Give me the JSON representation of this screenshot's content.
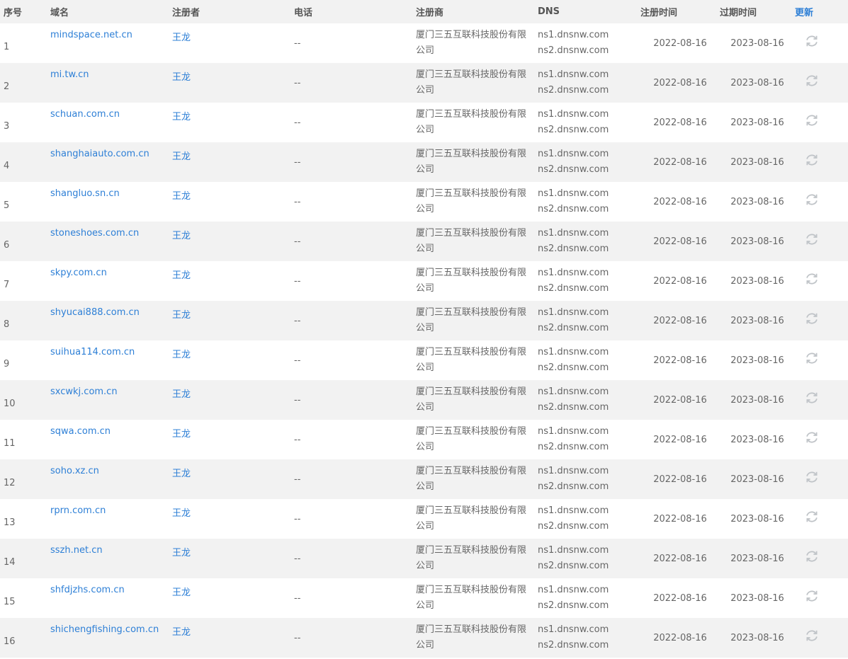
{
  "colors": {
    "link": "#2d7fd6",
    "row_alt": "#f2f2f2",
    "text": "#666666",
    "icon": "#c0c4c8"
  },
  "table": {
    "headers": {
      "index": "序号",
      "domain": "域名",
      "registrant": "注册者",
      "phone": "电话",
      "registrar": "注册商",
      "dns": "DNS",
      "reg_date": "注册时间",
      "exp_date": "过期时间",
      "update": "更新"
    },
    "rows": [
      {
        "index": "1",
        "domain": "mindspace.net.cn",
        "registrant": "王龙",
        "phone": "--",
        "registrar": "厦门三五互联科技股份有限公司",
        "dns1": "ns1.dnsnw.com",
        "dns2": "ns2.dnsnw.com",
        "reg_date": "2022-08-16",
        "exp_date": "2023-08-16",
        "update_icon": "refresh-icon"
      },
      {
        "index": "2",
        "domain": "mi.tw.cn",
        "registrant": "王龙",
        "phone": "--",
        "registrar": "厦门三五互联科技股份有限公司",
        "dns1": "ns1.dnsnw.com",
        "dns2": "ns2.dnsnw.com",
        "reg_date": "2022-08-16",
        "exp_date": "2023-08-16",
        "update_icon": "refresh-icon"
      },
      {
        "index": "3",
        "domain": "schuan.com.cn",
        "registrant": "王龙",
        "phone": "--",
        "registrar": "厦门三五互联科技股份有限公司",
        "dns1": "ns1.dnsnw.com",
        "dns2": "ns2.dnsnw.com",
        "reg_date": "2022-08-16",
        "exp_date": "2023-08-16",
        "update_icon": "refresh-icon"
      },
      {
        "index": "4",
        "domain": "shanghaiauto.com.cn",
        "registrant": "王龙",
        "phone": "--",
        "registrar": "厦门三五互联科技股份有限公司",
        "dns1": "ns1.dnsnw.com",
        "dns2": "ns2.dnsnw.com",
        "reg_date": "2022-08-16",
        "exp_date": "2023-08-16",
        "update_icon": "refresh-icon"
      },
      {
        "index": "5",
        "domain": "shangluo.sn.cn",
        "registrant": "王龙",
        "phone": "--",
        "registrar": "厦门三五互联科技股份有限公司",
        "dns1": "ns1.dnsnw.com",
        "dns2": "ns2.dnsnw.com",
        "reg_date": "2022-08-16",
        "exp_date": "2023-08-16",
        "update_icon": "refresh-icon"
      },
      {
        "index": "6",
        "domain": "stoneshoes.com.cn",
        "registrant": "王龙",
        "phone": "--",
        "registrar": "厦门三五互联科技股份有限公司",
        "dns1": "ns1.dnsnw.com",
        "dns2": "ns2.dnsnw.com",
        "reg_date": "2022-08-16",
        "exp_date": "2023-08-16",
        "update_icon": "refresh-icon"
      },
      {
        "index": "7",
        "domain": "skpy.com.cn",
        "registrant": "王龙",
        "phone": "--",
        "registrar": "厦门三五互联科技股份有限公司",
        "dns1": "ns1.dnsnw.com",
        "dns2": "ns2.dnsnw.com",
        "reg_date": "2022-08-16",
        "exp_date": "2023-08-16",
        "update_icon": "refresh-icon"
      },
      {
        "index": "8",
        "domain": "shyucai888.com.cn",
        "registrant": "王龙",
        "phone": "--",
        "registrar": "厦门三五互联科技股份有限公司",
        "dns1": "ns1.dnsnw.com",
        "dns2": "ns2.dnsnw.com",
        "reg_date": "2022-08-16",
        "exp_date": "2023-08-16",
        "update_icon": "refresh-icon"
      },
      {
        "index": "9",
        "domain": "suihua114.com.cn",
        "registrant": "王龙",
        "phone": "--",
        "registrar": "厦门三五互联科技股份有限公司",
        "dns1": "ns1.dnsnw.com",
        "dns2": "ns2.dnsnw.com",
        "reg_date": "2022-08-16",
        "exp_date": "2023-08-16",
        "update_icon": "refresh-icon"
      },
      {
        "index": "10",
        "domain": "sxcwkj.com.cn",
        "registrant": "王龙",
        "phone": "--",
        "registrar": "厦门三五互联科技股份有限公司",
        "dns1": "ns1.dnsnw.com",
        "dns2": "ns2.dnsnw.com",
        "reg_date": "2022-08-16",
        "exp_date": "2023-08-16",
        "update_icon": "refresh-icon"
      },
      {
        "index": "11",
        "domain": "sqwa.com.cn",
        "registrant": "王龙",
        "phone": "--",
        "registrar": "厦门三五互联科技股份有限公司",
        "dns1": "ns1.dnsnw.com",
        "dns2": "ns2.dnsnw.com",
        "reg_date": "2022-08-16",
        "exp_date": "2023-08-16",
        "update_icon": "refresh-icon"
      },
      {
        "index": "12",
        "domain": "soho.xz.cn",
        "registrant": "王龙",
        "phone": "--",
        "registrar": "厦门三五互联科技股份有限公司",
        "dns1": "ns1.dnsnw.com",
        "dns2": "ns2.dnsnw.com",
        "reg_date": "2022-08-16",
        "exp_date": "2023-08-16",
        "update_icon": "refresh-icon"
      },
      {
        "index": "13",
        "domain": "rprn.com.cn",
        "registrant": "王龙",
        "phone": "--",
        "registrar": "厦门三五互联科技股份有限公司",
        "dns1": "ns1.dnsnw.com",
        "dns2": "ns2.dnsnw.com",
        "reg_date": "2022-08-16",
        "exp_date": "2023-08-16",
        "update_icon": "refresh-icon"
      },
      {
        "index": "14",
        "domain": "sszh.net.cn",
        "registrant": "王龙",
        "phone": "--",
        "registrar": "厦门三五互联科技股份有限公司",
        "dns1": "ns1.dnsnw.com",
        "dns2": "ns2.dnsnw.com",
        "reg_date": "2022-08-16",
        "exp_date": "2023-08-16",
        "update_icon": "refresh-icon"
      },
      {
        "index": "15",
        "domain": "shfdjzhs.com.cn",
        "registrant": "王龙",
        "phone": "--",
        "registrar": "厦门三五互联科技股份有限公司",
        "dns1": "ns1.dnsnw.com",
        "dns2": "ns2.dnsnw.com",
        "reg_date": "2022-08-16",
        "exp_date": "2023-08-16",
        "update_icon": "refresh-icon"
      },
      {
        "index": "16",
        "domain": "shichengfishing.com.cn",
        "registrant": "王龙",
        "phone": "--",
        "registrar": "厦门三五互联科技股份有限公司",
        "dns1": "ns1.dnsnw.com",
        "dns2": "ns2.dnsnw.com",
        "reg_date": "2022-08-16",
        "exp_date": "2023-08-16",
        "update_icon": "refresh-icon"
      }
    ]
  }
}
